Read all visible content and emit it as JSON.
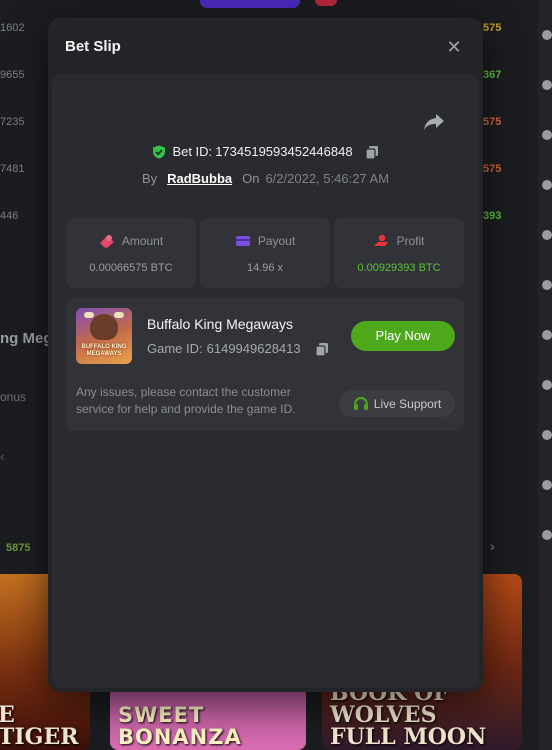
{
  "modal": {
    "title": "Bet Slip",
    "bet_id_label": "Bet ID:",
    "bet_id": "1734519593452446848",
    "by_label": "By",
    "username": "RadBubba",
    "on_label": "On",
    "datetime": "6/2/2022, 5:46:27 AM"
  },
  "stats": [
    {
      "label": "Amount",
      "value": "0.00066575 BTC",
      "icon": "coins-icon",
      "color": "#e8456b"
    },
    {
      "label": "Payout",
      "value": "14.96 x",
      "icon": "card-icon",
      "color": "#7b4fe0"
    },
    {
      "label": "Profit",
      "value": "0.00929393 BTC",
      "icon": "profit-icon",
      "color": "#e8333b"
    }
  ],
  "game": {
    "name": "Buffalo King Megaways",
    "id_label": "Game ID:",
    "id": "6149949628413",
    "thumb_text": "BUFFALO KING MEGAWAYS",
    "play_label": "Play Now",
    "issue_text": "Any issues, please contact the customer service for help and provide the game ID.",
    "support_label": "Live Support"
  },
  "background": {
    "left_values": [
      "1602",
      "9655",
      "7235",
      "7481",
      "446"
    ],
    "right_values": [
      "575",
      "367",
      "575",
      "575",
      "393"
    ],
    "heading": "ng Meg",
    "sub": "onus",
    "bottom_green": "5875",
    "tiles": [
      "E TIGER",
      "SWEET BONANZA",
      "BOOK OF WOLVES FULL MOON"
    ]
  },
  "colors": {
    "accent_green": "#4ea81c",
    "profit_green": "#5bc23a",
    "shield_green": "#35c04a",
    "modal_bg": "#232427"
  }
}
